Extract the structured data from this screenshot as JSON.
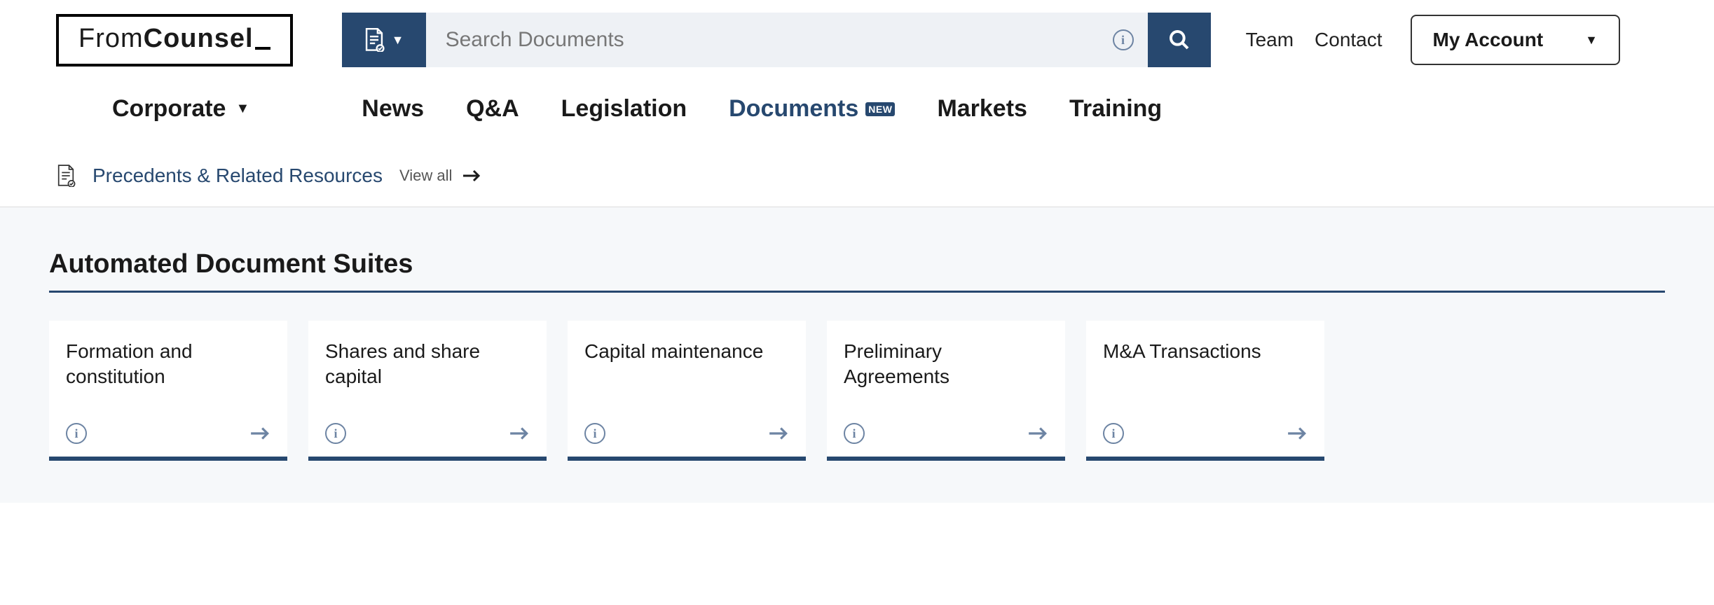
{
  "logo": {
    "part1": "From",
    "part2": "Counsel"
  },
  "search": {
    "placeholder": "Search Documents"
  },
  "topLinks": {
    "team": "Team",
    "contact": "Contact",
    "account": "My Account"
  },
  "nav": {
    "corporate": "Corporate",
    "items": [
      {
        "label": "News"
      },
      {
        "label": "Q&A"
      },
      {
        "label": "Legislation"
      },
      {
        "label": "Documents",
        "active": true,
        "badge": "NEW"
      },
      {
        "label": "Markets"
      },
      {
        "label": "Training"
      }
    ]
  },
  "subheader": {
    "title": "Precedents & Related Resources",
    "viewAll": "View all"
  },
  "section": {
    "title": "Automated Document Suites",
    "cards": [
      {
        "title": "Formation and constitution"
      },
      {
        "title": "Shares and share capital"
      },
      {
        "title": "Capital maintenance"
      },
      {
        "title": "Preliminary Agreements"
      },
      {
        "title": "M&A Transactions"
      }
    ]
  }
}
